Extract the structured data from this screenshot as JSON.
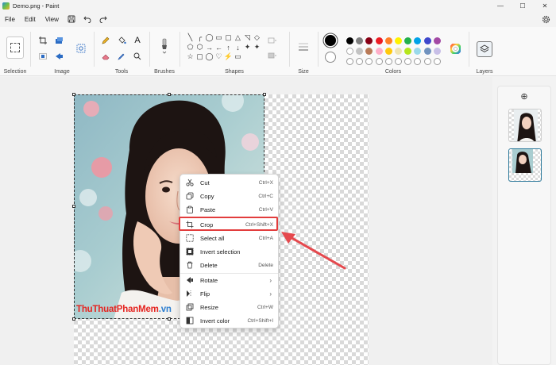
{
  "window": {
    "title": "Demo.png - Paint",
    "minimize_glyph": "—",
    "maximize_glyph": "☐",
    "close_glyph": "✕"
  },
  "menu": {
    "file": "File",
    "edit": "Edit",
    "view": "View"
  },
  "ribbon": {
    "selection_label": "Selection",
    "image_label": "Image",
    "tools_label": "Tools",
    "brushes_label": "Brushes",
    "shapes_label": "Shapes",
    "size_label": "Size",
    "colors_label": "Colors",
    "layers_label": "Layers",
    "text_tool_glyph": "A",
    "shape_glyphs": [
      "╲",
      "╭",
      "◯",
      "▭",
      "▢",
      "△",
      "◹",
      "◇",
      "⬠",
      "⬡",
      "→",
      "←",
      "↑",
      "↓",
      "✦",
      "✦",
      "☆",
      "▢",
      "◯",
      "♡",
      "⚡",
      "▭"
    ]
  },
  "colors": {
    "primary": "#000000",
    "secondary": "#ffffff",
    "palette_row1": [
      "#000000",
      "#7f7f7f",
      "#880015",
      "#ed1c24",
      "#ff7f27",
      "#fff200",
      "#22b14c",
      "#00a2e8",
      "#3f48cc",
      "#a349a4"
    ],
    "palette_row2": [
      "#ffffff",
      "#c3c3c3",
      "#b97a57",
      "#ffaec9",
      "#ffc90e",
      "#efe4b0",
      "#b5e61d",
      "#99d9ea",
      "#7092be",
      "#c8bfe7"
    ],
    "accent_highlight": "#e23d3d",
    "arrow_color": "#e5484d"
  },
  "context_menu": {
    "items": [
      {
        "label": "Cut",
        "shortcut": "Ctrl+X"
      },
      {
        "label": "Copy",
        "shortcut": "Ctrl+C"
      },
      {
        "label": "Paste",
        "shortcut": "Ctrl+V"
      },
      {
        "label": "Crop",
        "shortcut": "Ctrl+Shift+X"
      },
      {
        "label": "Select all",
        "shortcut": "Ctrl+A"
      },
      {
        "label": "Invert selection",
        "shortcut": ""
      },
      {
        "label": "Delete",
        "shortcut": "Delete"
      },
      {
        "label": "Rotate",
        "shortcut": ""
      },
      {
        "label": "Flip",
        "shortcut": ""
      },
      {
        "label": "Resize",
        "shortcut": "Ctrl+W"
      },
      {
        "label": "Invert color",
        "shortcut": "Ctrl+Shift+I"
      }
    ],
    "submenu_glyph": "›"
  },
  "watermark": {
    "part1": "ThuThuat",
    "part2": "PhanMem",
    "part3": ".vn"
  },
  "layers": {
    "add_glyph": "⊕"
  }
}
